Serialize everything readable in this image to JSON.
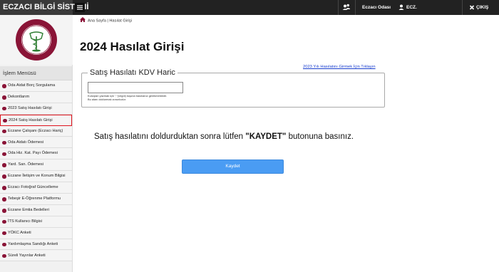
{
  "app": {
    "title": "ECZACI BİLGİ SİSTEMİ"
  },
  "topbar": {
    "user_org": "Eczacı Odası",
    "user_name": "ECZ.",
    "logout_label": "ÇIKIŞ"
  },
  "logo": {
    "text": "TÜRK ECZACILARI BİRLİĞİ"
  },
  "sidebar": {
    "title": "İşlem Menüsü",
    "items": [
      {
        "label": "Oda Aidat Borç Sorgulama"
      },
      {
        "label": "Dekontlarım"
      },
      {
        "label": "2023 Satış Hasılatı Girişi"
      },
      {
        "label": "2024 Satış Hasılatı Girişi",
        "active": true
      },
      {
        "label": "Eczane Çalışanı (Eczacı Hariç)"
      },
      {
        "label": "Oda Aidatı Ödemesi"
      },
      {
        "label": "Oda Hiz. Kat. Payı Ödemesi"
      },
      {
        "label": "Yard. San. Ödemesi"
      },
      {
        "label": "Eczane İletişim ve Konum Bilgisi"
      },
      {
        "label": "Eczacı Fotoğraf Güncelleme"
      },
      {
        "label": "Tebeşir E-Öğrenme Platformu"
      },
      {
        "label": "Eczane Emtia Bedelleri"
      },
      {
        "label": "İTS Kullanıcı Bilgisi"
      },
      {
        "label": "YÖKC Anketi"
      },
      {
        "label": "Yardımlaşma Sandığı Anketi"
      },
      {
        "label": "Süreli Yayınlar Anketi"
      }
    ]
  },
  "breadcrumb": {
    "text": "Ana Sayfa | Hasılat Girişi"
  },
  "main": {
    "title": "2024 Hasılat Girişi",
    "link_2023": "2023 Yılı Hasılatını Girmek İçin Tıklayın",
    "fieldset_legend": "Satış Hasılatı KDV Haric",
    "input_value": "",
    "hint_line1": "Kuruşları yazmak için \",\"(virgül) tuşuna basmanız gerekmektedir.",
    "hint_line2": "Bu alanı doldurmak zorunludur.",
    "instruction_before": "Satış hasılatını doldurduktan sonra lütfen ",
    "instruction_bold": "\"KAYDET\"",
    "instruction_after": " butonuna basınız.",
    "save_label": "Kaydet"
  },
  "colors": {
    "topbar": "#222222",
    "accent": "#4a9cf3",
    "menu_dot": "#8a1437",
    "active_outline": "#e0141e",
    "link": "#1a3fcf"
  }
}
